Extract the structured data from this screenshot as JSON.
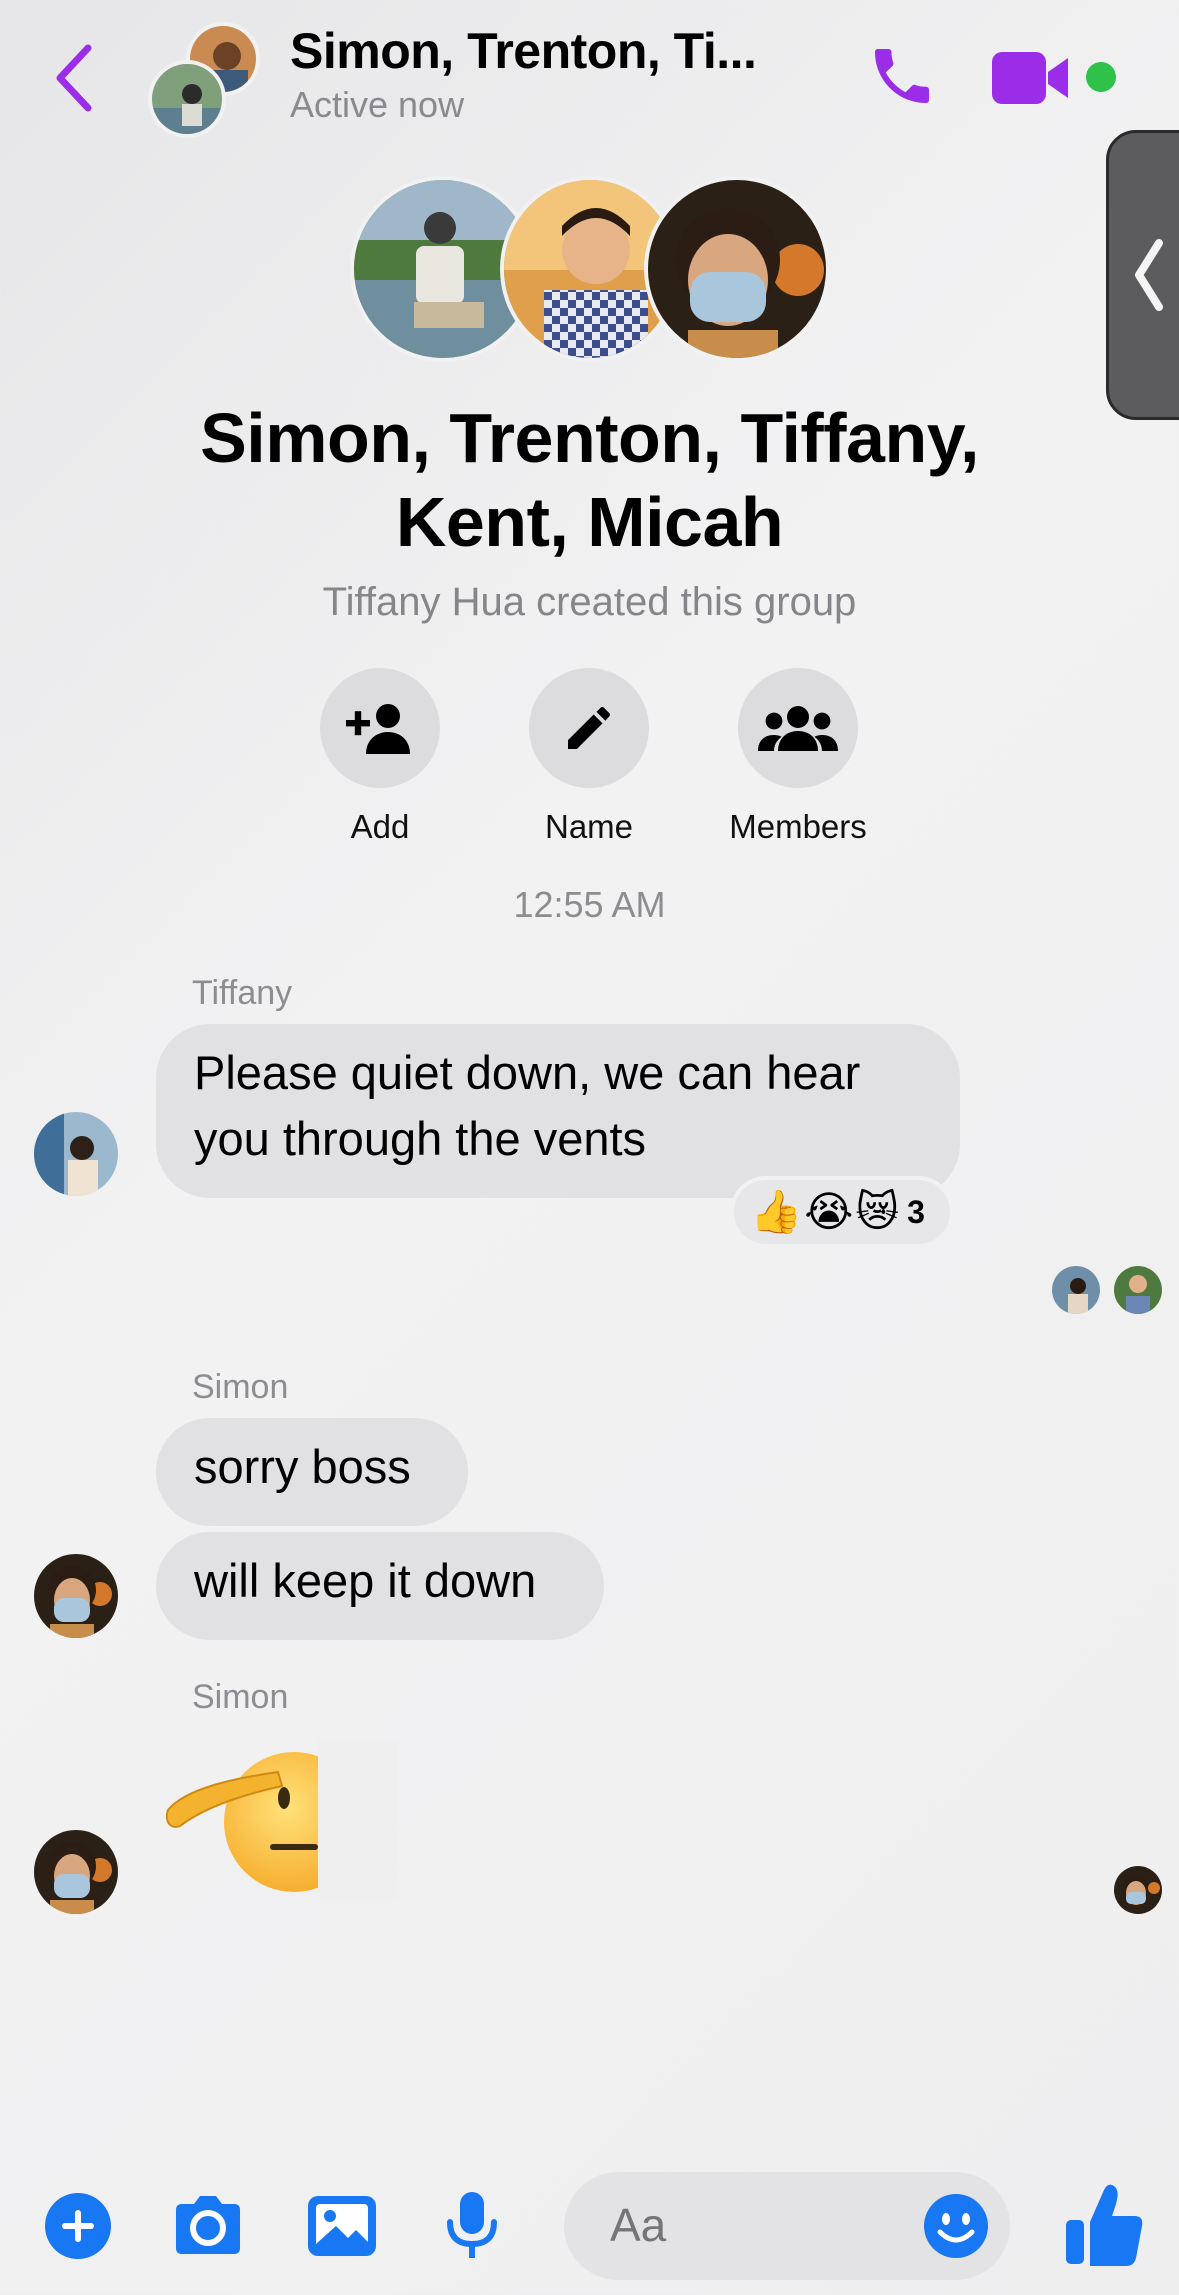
{
  "header": {
    "title": "Simon, Trenton, Ti...",
    "status": "Active now"
  },
  "group": {
    "name_line1": "Simon, Trenton, Tiffany,",
    "name_line2": "Kent, Micah",
    "created_by": "Tiffany Hua created this group"
  },
  "actions": [
    {
      "label": "Add",
      "icon": "add-person-icon"
    },
    {
      "label": "Name",
      "icon": "pencil-icon"
    },
    {
      "label": "Members",
      "icon": "members-icon"
    }
  ],
  "timestamp": "12:55 AM",
  "messages": [
    {
      "sender": "Tiffany",
      "line1": "Please quiet down, we can hear",
      "line2": "you through the vents",
      "reactions": [
        "👍",
        "😭",
        "😿"
      ],
      "reaction_count": "3"
    },
    {
      "sender": "Simon",
      "text": "sorry boss"
    },
    {
      "text": "will keep it down"
    },
    {
      "sender": "Simon",
      "emoji": "saluting-face"
    }
  ],
  "composer": {
    "placeholder": "Aa"
  },
  "bottom_bar": [
    "plus-icon",
    "camera-icon",
    "photo-icon",
    "microphone-icon",
    "emoji-icon",
    "thumbs-up-icon"
  ],
  "colors": {
    "accent_purple": "#9b2de8",
    "accent_blue": "#1877f2",
    "online": "#2fc14a",
    "bubble": "#e1e1e3"
  }
}
